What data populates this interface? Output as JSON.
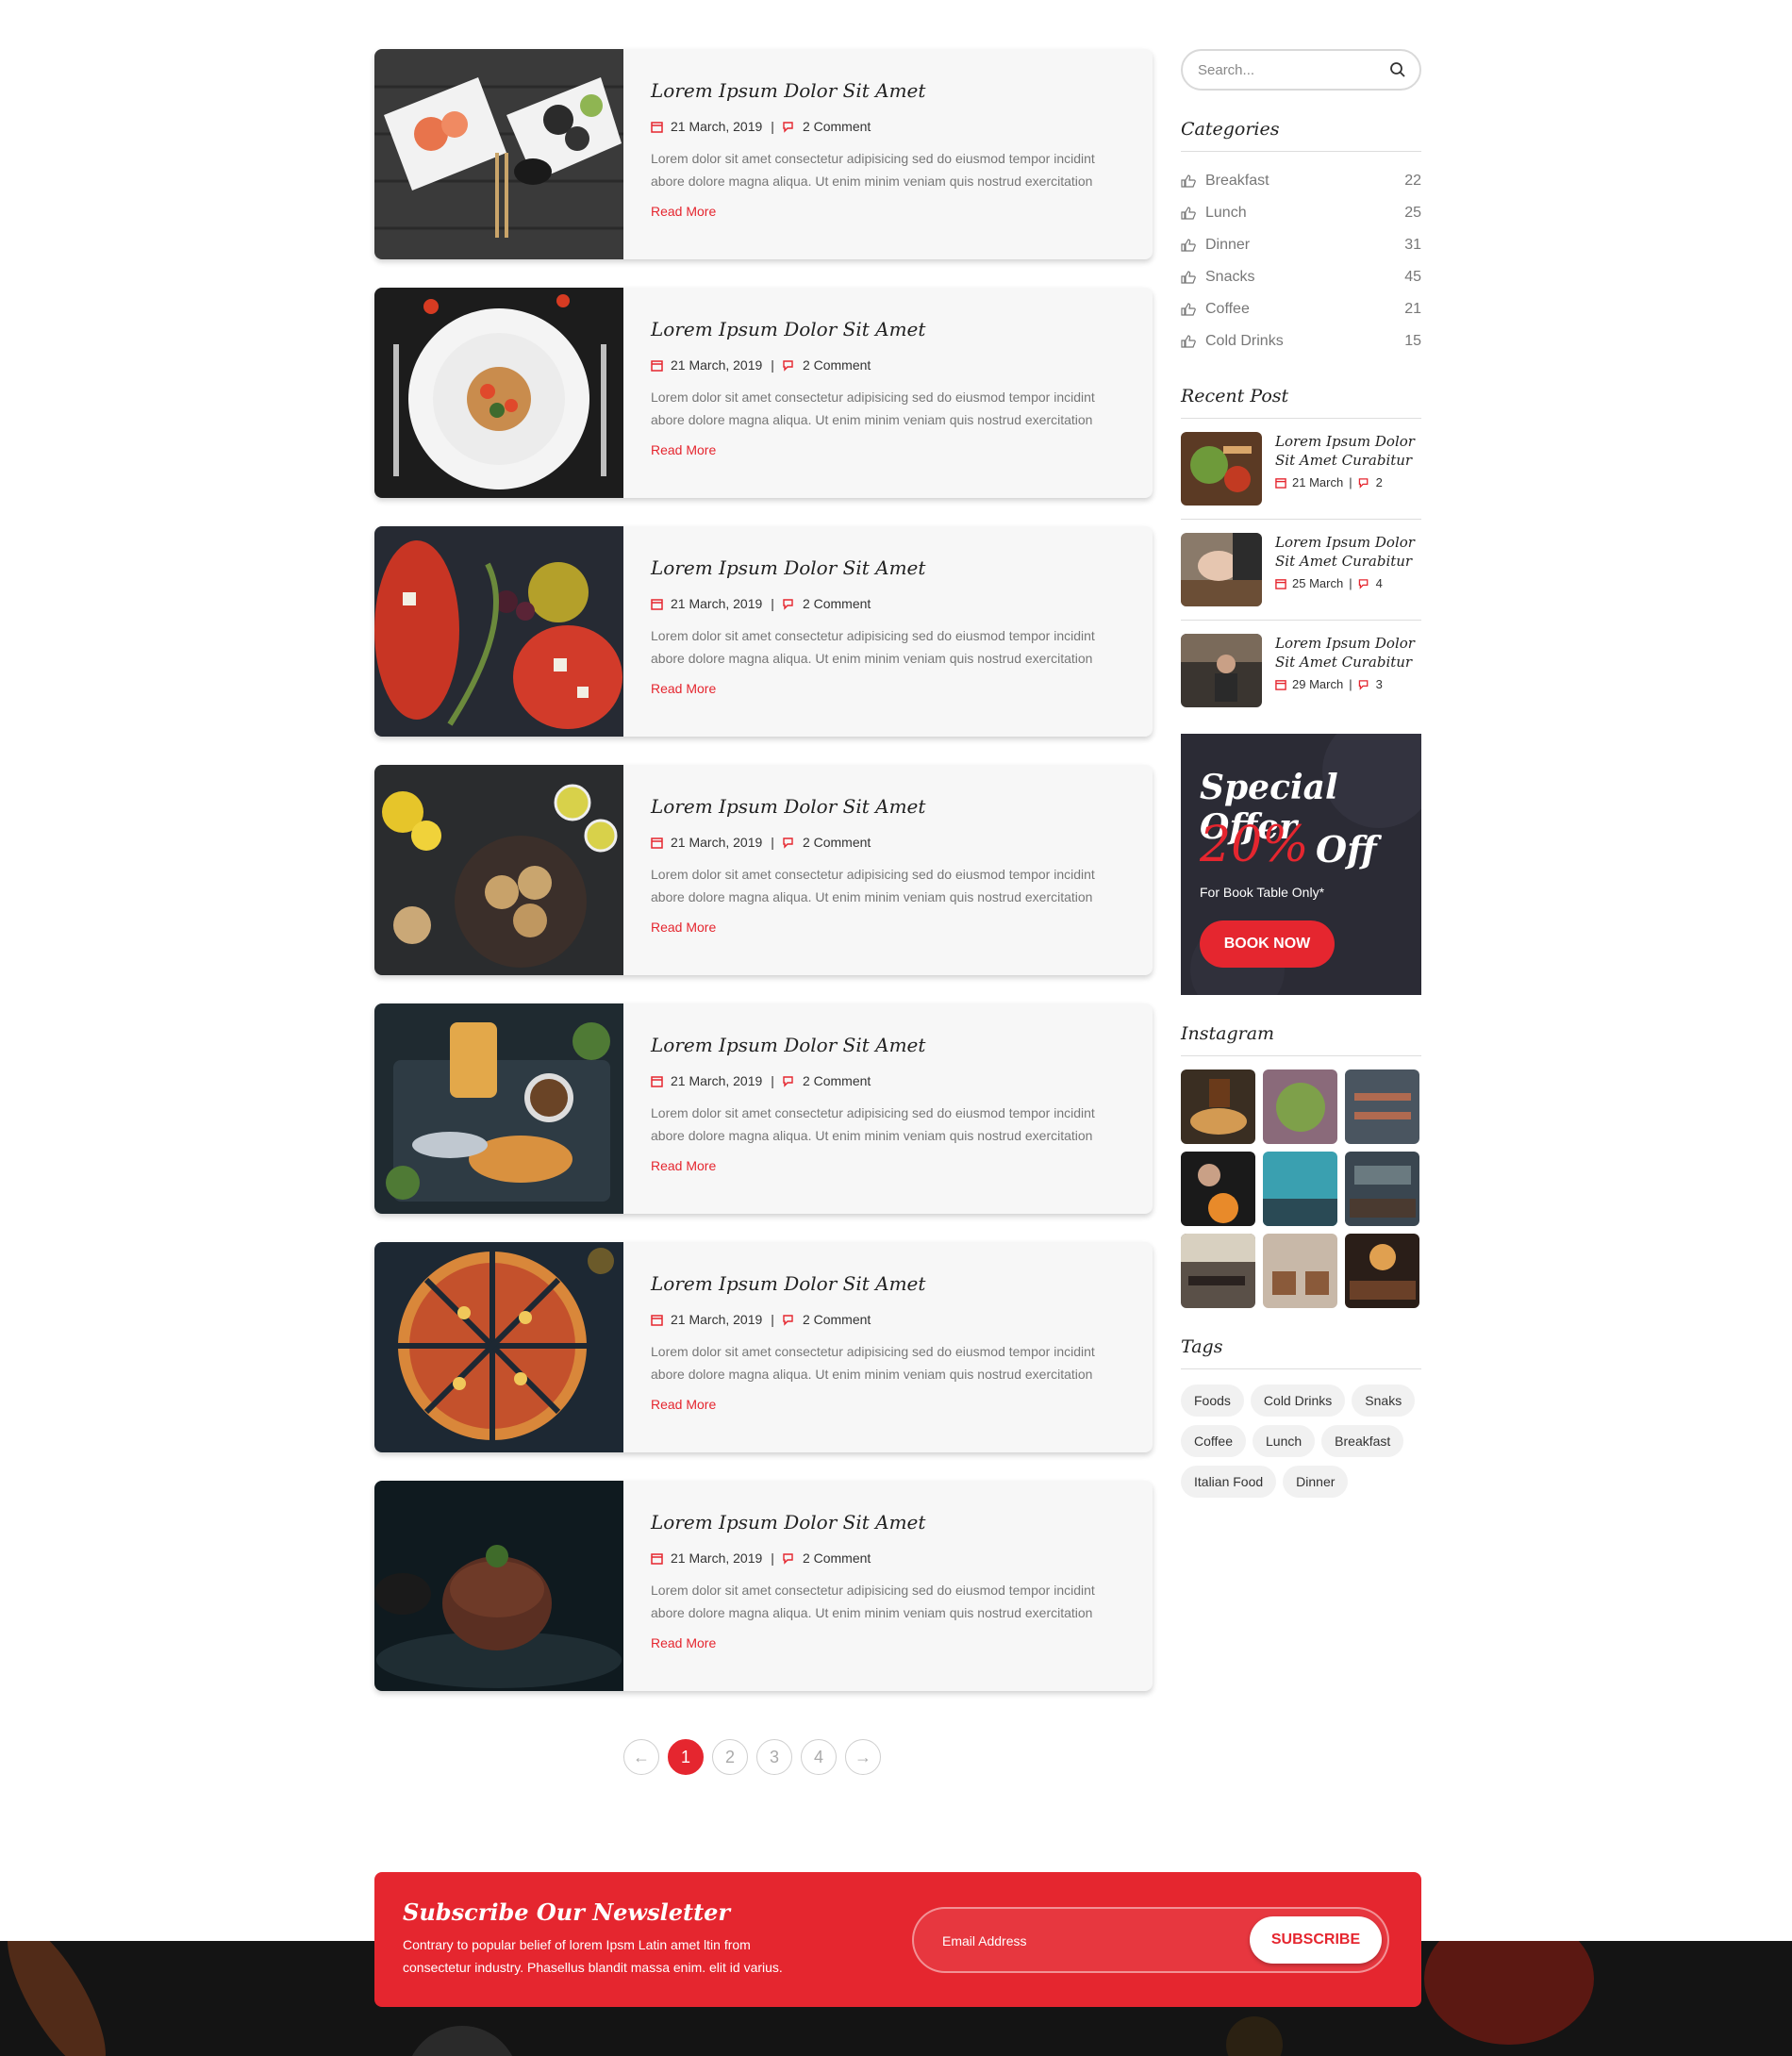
{
  "posts": [
    {
      "title": "Lorem Ipsum Dolor Sit Amet",
      "date": "21 March, 2019",
      "comments": "2 Comment",
      "excerpt": "Lorem dolor sit amet consectetur adipisicing sed do eiusmod tempor incidint abore dolore magna aliqua. Ut enim minim veniam quis nostrud exercitation",
      "read_more": "Read More"
    },
    {
      "title": "Lorem Ipsum Dolor Sit Amet",
      "date": "21 March, 2019",
      "comments": "2 Comment",
      "excerpt": "Lorem dolor sit amet consectetur adipisicing sed do eiusmod tempor incidint abore dolore magna aliqua. Ut enim minim veniam quis nostrud exercitation",
      "read_more": "Read More"
    },
    {
      "title": "Lorem Ipsum Dolor Sit Amet",
      "date": "21 March, 2019",
      "comments": "2 Comment",
      "excerpt": "Lorem dolor sit amet consectetur adipisicing sed do eiusmod tempor incidint abore dolore magna aliqua. Ut enim minim veniam quis nostrud exercitation",
      "read_more": "Read More"
    },
    {
      "title": "Lorem Ipsum Dolor Sit Amet",
      "date": "21 March, 2019",
      "comments": "2 Comment",
      "excerpt": "Lorem dolor sit amet consectetur adipisicing sed do eiusmod tempor incidint abore dolore magna aliqua. Ut enim minim veniam quis nostrud exercitation",
      "read_more": "Read More"
    },
    {
      "title": "Lorem Ipsum Dolor Sit Amet",
      "date": "21 March, 2019",
      "comments": "2 Comment",
      "excerpt": "Lorem dolor sit amet consectetur adipisicing sed do eiusmod tempor incidint abore dolore magna aliqua. Ut enim minim veniam quis nostrud exercitation",
      "read_more": "Read More"
    },
    {
      "title": "Lorem Ipsum Dolor Sit Amet",
      "date": "21 March, 2019",
      "comments": "2 Comment",
      "excerpt": "Lorem dolor sit amet consectetur adipisicing sed do eiusmod tempor incidint abore dolore magna aliqua. Ut enim minim veniam quis nostrud exercitation",
      "read_more": "Read More"
    },
    {
      "title": "Lorem Ipsum Dolor Sit Amet",
      "date": "21 March, 2019",
      "comments": "2 Comment",
      "excerpt": "Lorem dolor sit amet consectetur adipisicing sed do eiusmod tempor incidint abore dolore magna aliqua. Ut enim minim veniam quis nostrud exercitation",
      "read_more": "Read More"
    }
  ],
  "pagination": {
    "prev": "←",
    "pages": [
      "1",
      "2",
      "3",
      "4"
    ],
    "next": "→",
    "active": "1"
  },
  "sidebar": {
    "search_placeholder": "Search...",
    "categories_title": "Categories",
    "categories": [
      {
        "label": "Breakfast",
        "count": "22"
      },
      {
        "label": "Lunch",
        "count": "25"
      },
      {
        "label": "Dinner",
        "count": "31"
      },
      {
        "label": "Snacks",
        "count": "45"
      },
      {
        "label": "Coffee",
        "count": "21"
      },
      {
        "label": "Cold Drinks",
        "count": "15"
      }
    ],
    "recent_title": "Recent Post",
    "recent": [
      {
        "title": "Lorem Ipsum Dolor Sit Amet Curabitur",
        "date": "21 March",
        "comments": "2"
      },
      {
        "title": "Lorem Ipsum Dolor Sit Amet Curabitur",
        "date": "25 March",
        "comments": "4"
      },
      {
        "title": "Lorem Ipsum Dolor Sit Amet Curabitur",
        "date": "29 March",
        "comments": "3"
      }
    ],
    "offer": {
      "title": "Special Offer",
      "percent": "20%",
      "off": "Off",
      "note": "For Book Table Only*",
      "button": "BOOK NOW"
    },
    "instagram_title": "Instagram",
    "tags_title": "Tags",
    "tags": [
      "Foods",
      "Cold Drinks",
      "Snaks",
      "Coffee",
      "Lunch",
      "Breakfast",
      "Italian Food",
      "Dinner"
    ]
  },
  "newsletter": {
    "title": "Subscribe Our Newsletter",
    "description": "Contrary to popular belief of lorem Ipsm Latin amet ltin from consectetur industry. Phasellus blandit massa enim. elit id varius.",
    "email_placeholder": "Email Address",
    "button": "SUBSCRIBE"
  },
  "colors": {
    "accent": "#e5262f",
    "card_bg": "#f7f7f7",
    "dark": "#141414"
  }
}
